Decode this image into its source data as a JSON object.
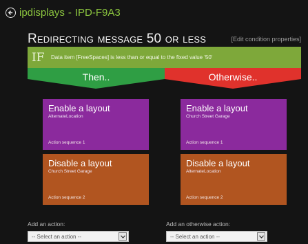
{
  "header": {
    "app_name": "ipdisplays",
    "separator": "-",
    "device_id": "IPD-F9A3"
  },
  "page": {
    "title": "Redirecting message 50 or less",
    "edit_link": "[Edit condition properties]"
  },
  "condition": {
    "if_label": "IF",
    "text": "Data item [FreeSpaces] is less than or equal to the fixed value '50'"
  },
  "branches": {
    "then_label": "Then..",
    "otherwise_label": "Otherwise..",
    "then_color": "#2f9e44",
    "otherwise_color": "#e0322c"
  },
  "then_actions": [
    {
      "action": "Enable a layout",
      "target": "AlternateLocation",
      "sequence": "Action sequence 1",
      "color": "#8b2a9d"
    },
    {
      "action": "Disable a layout",
      "target": "Church Street Garage",
      "sequence": "Action sequence 2",
      "color": "#b15520"
    }
  ],
  "otherwise_actions": [
    {
      "action": "Enable a layout",
      "target": "Church Street Garage",
      "sequence": "Action sequence 1",
      "color": "#8b2a9d"
    },
    {
      "action": "Disable a layout",
      "target": "AlternateLocation",
      "sequence": "Action sequence 2",
      "color": "#b15520"
    }
  ],
  "add_action": {
    "label": "Add an action:",
    "placeholder": "-- Select an action --"
  },
  "add_otherwise_action": {
    "label": "Add an otherwise action:",
    "placeholder": "-- Select an action --"
  },
  "icons": {
    "back": "back-arrow-circle-icon",
    "dropdown": "chevron-down-icon"
  }
}
